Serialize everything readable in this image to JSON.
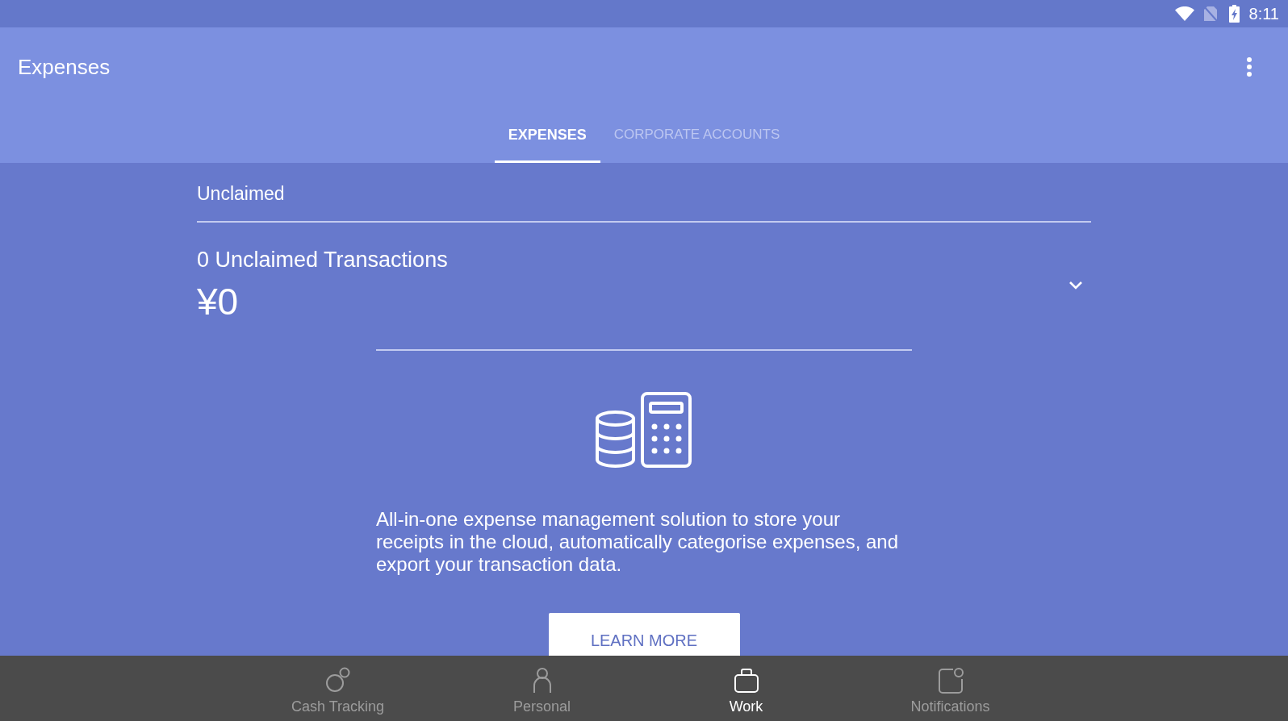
{
  "status_bar": {
    "time": "8:11"
  },
  "app_bar": {
    "title": "Expenses"
  },
  "tabs": [
    {
      "label": "EXPENSES",
      "selected": true
    },
    {
      "label": "CORPORATE ACCOUNTS",
      "selected": false
    }
  ],
  "unclaimed": {
    "heading": "Unclaimed",
    "summary": "0 Unclaimed Transactions",
    "amount": "¥0",
    "expanded": false
  },
  "promo": {
    "description": "All-in-one expense management solution to store your receipts in the cloud, automatically categorise expenses, and export your transaction data.",
    "button": "LEARN MORE"
  },
  "bottom_nav": [
    {
      "label": "Cash Tracking",
      "selected": false
    },
    {
      "label": "Personal",
      "selected": false
    },
    {
      "label": "Work",
      "selected": true
    },
    {
      "label": "Notifications",
      "selected": false
    }
  ]
}
